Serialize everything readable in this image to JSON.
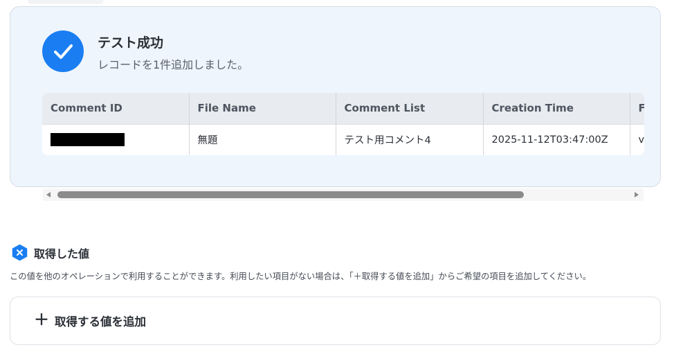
{
  "success": {
    "title": "テスト成功",
    "subtitle": "レコードを1件追加しました。",
    "icon": "check-icon",
    "accent": "#1a7ef2"
  },
  "table": {
    "headers": [
      "Comment ID",
      "File Name",
      "Comment List",
      "Creation Time",
      "F"
    ],
    "rows": [
      {
        "comment_id": "[REDACTED]",
        "file_name": "無題",
        "comment_list": "テスト用コメント4",
        "creation_time": "2025-11-12T03:47:00Z",
        "extra": "v"
      }
    ]
  },
  "acquired": {
    "icon": "x-hexagon-icon",
    "title": "取得した値",
    "description": "この値を他のオペレーションで利用することができます。利用したい項目がない場合は、「＋取得する値を追加」からご希望の項目を追加してください。",
    "add_label": "取得する値を追加",
    "add_icon": "plus-icon"
  }
}
